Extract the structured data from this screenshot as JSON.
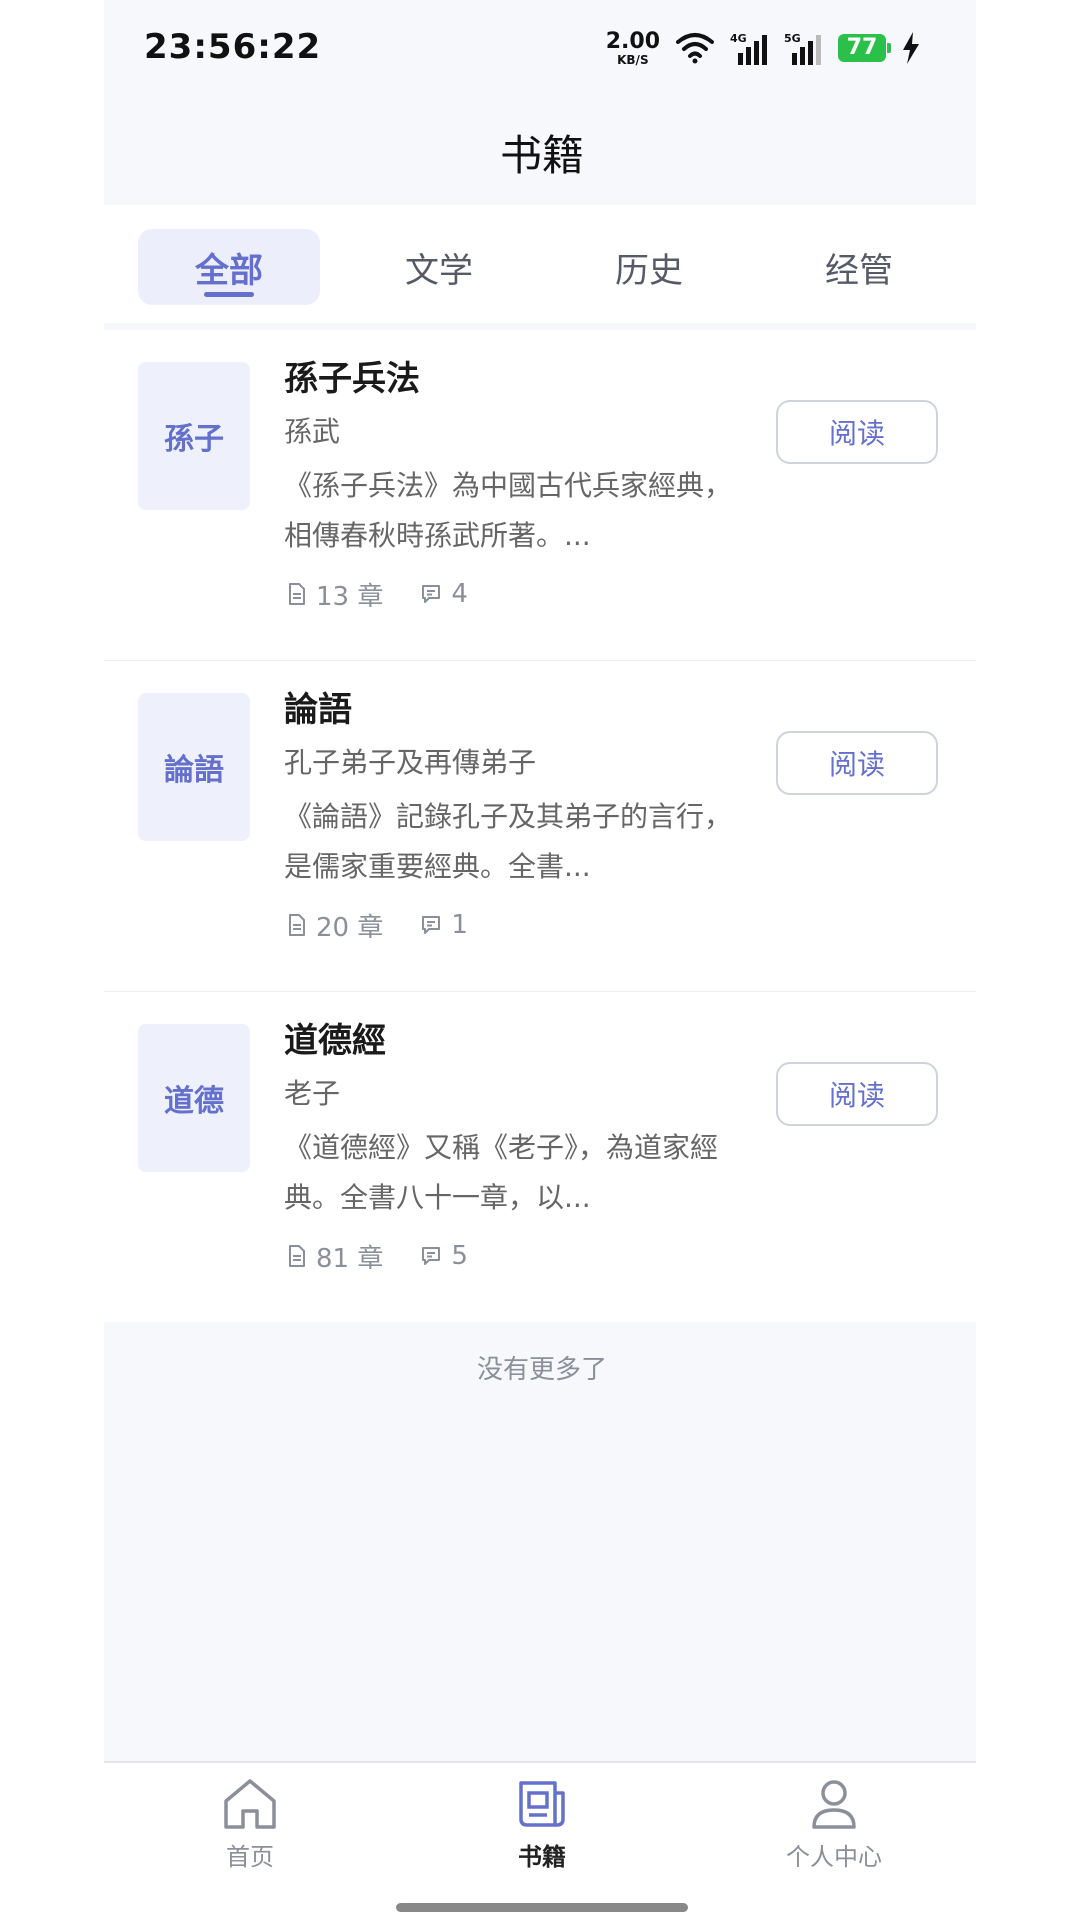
{
  "status_bar": {
    "time": "23:56:22",
    "net_speed": "2.00",
    "net_speed_unit": "KB/S",
    "signal_1_label": "4G",
    "signal_2_label": "5G",
    "battery_level": "77"
  },
  "header": {
    "title": "书籍"
  },
  "tabs": [
    {
      "label": "全部",
      "active": true
    },
    {
      "label": "文学",
      "active": false
    },
    {
      "label": "历史",
      "active": false
    },
    {
      "label": "经管",
      "active": false
    }
  ],
  "books": [
    {
      "cover_text": "孫子",
      "title": "孫子兵法",
      "author": "孫武",
      "description": "《孫子兵法》為中國古代兵家經典，相傳春秋時孫武所著。...",
      "chapters": "13 章",
      "comments": "4",
      "action_label": "阅读"
    },
    {
      "cover_text": "論語",
      "title": "論語",
      "author": "孔子弟子及再傳弟子",
      "description": "《論語》記錄孔子及其弟子的言行，是儒家重要經典。全書...",
      "chapters": "20 章",
      "comments": "1",
      "action_label": "阅读"
    },
    {
      "cover_text": "道德",
      "title": "道德經",
      "author": "老子",
      "description": "《道德經》又稱《老子》，為道家經典。全書八十一章，以...",
      "chapters": "81 章",
      "comments": "5",
      "action_label": "阅读"
    }
  ],
  "list_footer": "没有更多了",
  "bottom_nav": [
    {
      "label": "首页",
      "icon": "home-icon",
      "active": false
    },
    {
      "label": "书籍",
      "icon": "book-icon",
      "active": true
    },
    {
      "label": "个人中心",
      "icon": "user-icon",
      "active": false
    }
  ],
  "colors": {
    "accent": "#6470cc",
    "cover_bg": "#eef0fb",
    "page_bg": "#f7f8fc",
    "battery": "#2ac04a"
  }
}
